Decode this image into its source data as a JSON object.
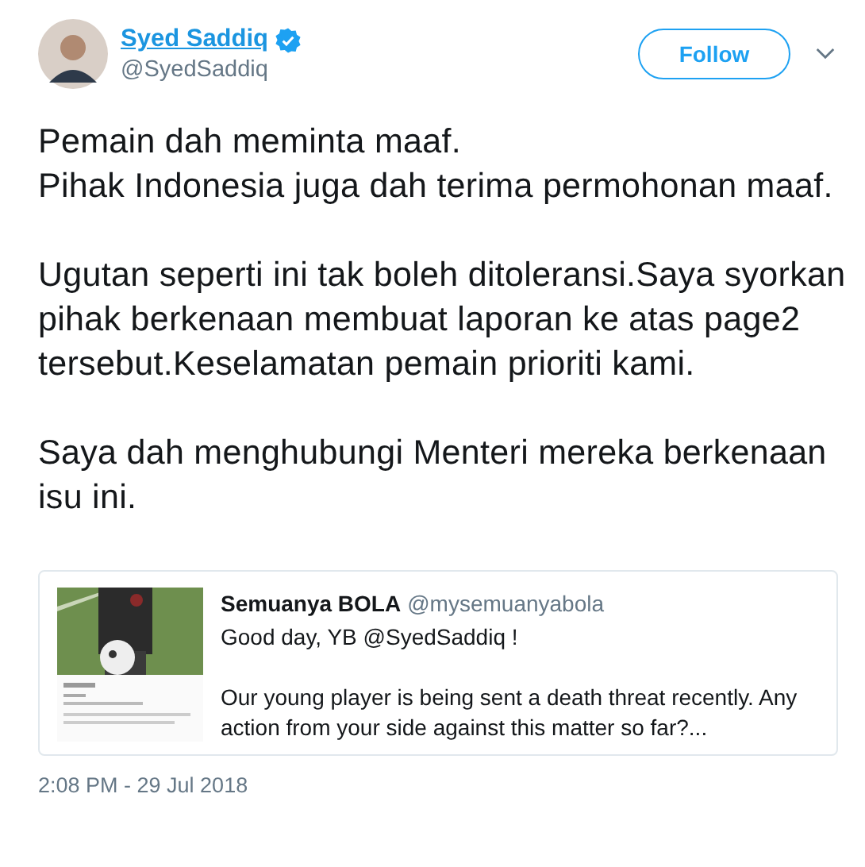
{
  "author": {
    "name": "Syed Saddiq",
    "verified": true,
    "handle": "@SyedSaddiq"
  },
  "follow_button": "Follow",
  "paragraphs": [
    "Pemain dah meminta maaf.\nPihak Indonesia juga dah terima permohonan maaf.",
    "Ugutan seperti ini tak boleh ditoleransi.Saya syorkan pihak berkenaan membuat laporan ke atas page2 tersebut.Keselamatan pemain prioriti kami.",
    "Saya dah menghubungi Menteri mereka berkenaan isu ini."
  ],
  "quoted_tweet": {
    "media": {
      "kind": "picture"
    },
    "name": "Semuanya BOLA",
    "handle": "@mysemuanyabola",
    "paragraphs": [
      "Good day, YB @SyedSaddiq !",
      "Our young player is being sent a death threat recently. Any action from your side against this matter so far?..."
    ]
  },
  "timestamp": "2:08 PM - 29 Jul 2018"
}
